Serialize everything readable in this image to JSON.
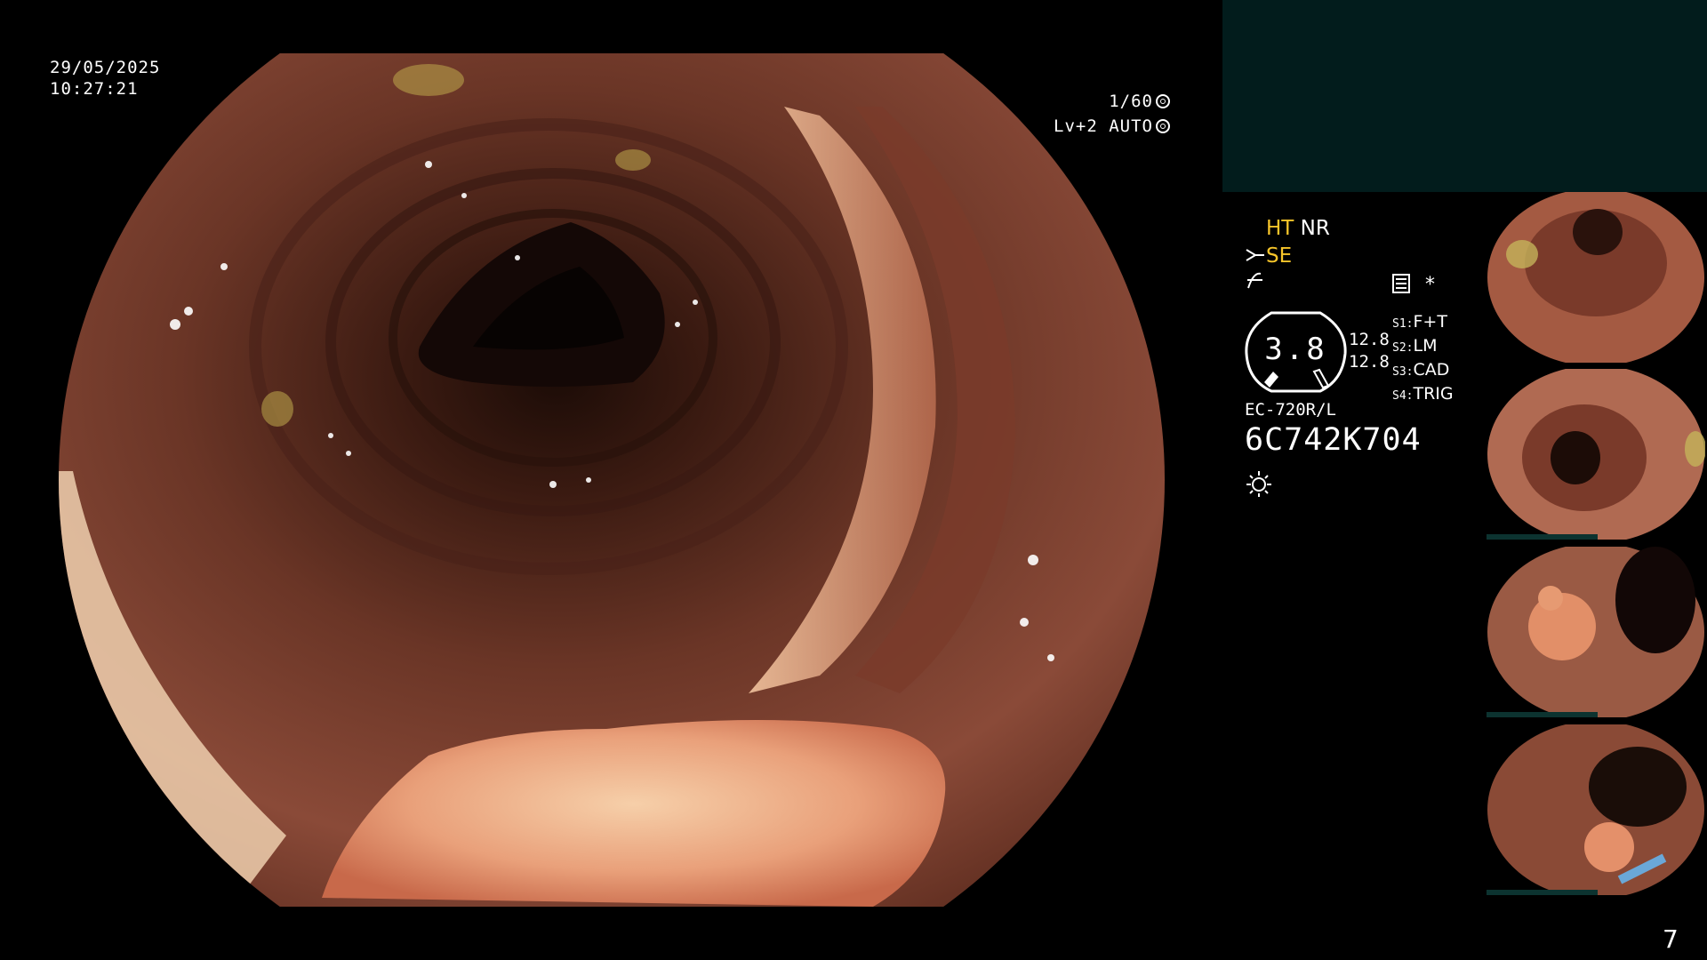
{
  "osd": {
    "date": "29/05/2025",
    "time": "10:27:21",
    "shutter": "1/60",
    "level": "Lv+2 AUTO"
  },
  "settings": {
    "ht": "HT",
    "nr": "NR",
    "se": "SE",
    "gauge_value": "3.8",
    "gauge_num_1": "12.8",
    "gauge_num_2": "12.8",
    "slots": [
      {
        "label": "S1:",
        "value": "F+T"
      },
      {
        "label": "S2:",
        "value": "LM"
      },
      {
        "label": "S3:",
        "value": "CAD"
      },
      {
        "label": "S4:",
        "value": "TRIG"
      }
    ],
    "asterisk": "*",
    "scope_model": "EC-720R/L",
    "scope_serial": "6C742K704"
  },
  "page_number": "7",
  "icons": [
    "scissors-icon",
    "sharpness-icon",
    "memory-icon",
    "light-icon",
    "shutter-icon",
    "auto-iris-icon"
  ],
  "colors": {
    "accent": "#f7c52a",
    "panel": "#021c1c",
    "thumb_bar": "#0c3330"
  }
}
